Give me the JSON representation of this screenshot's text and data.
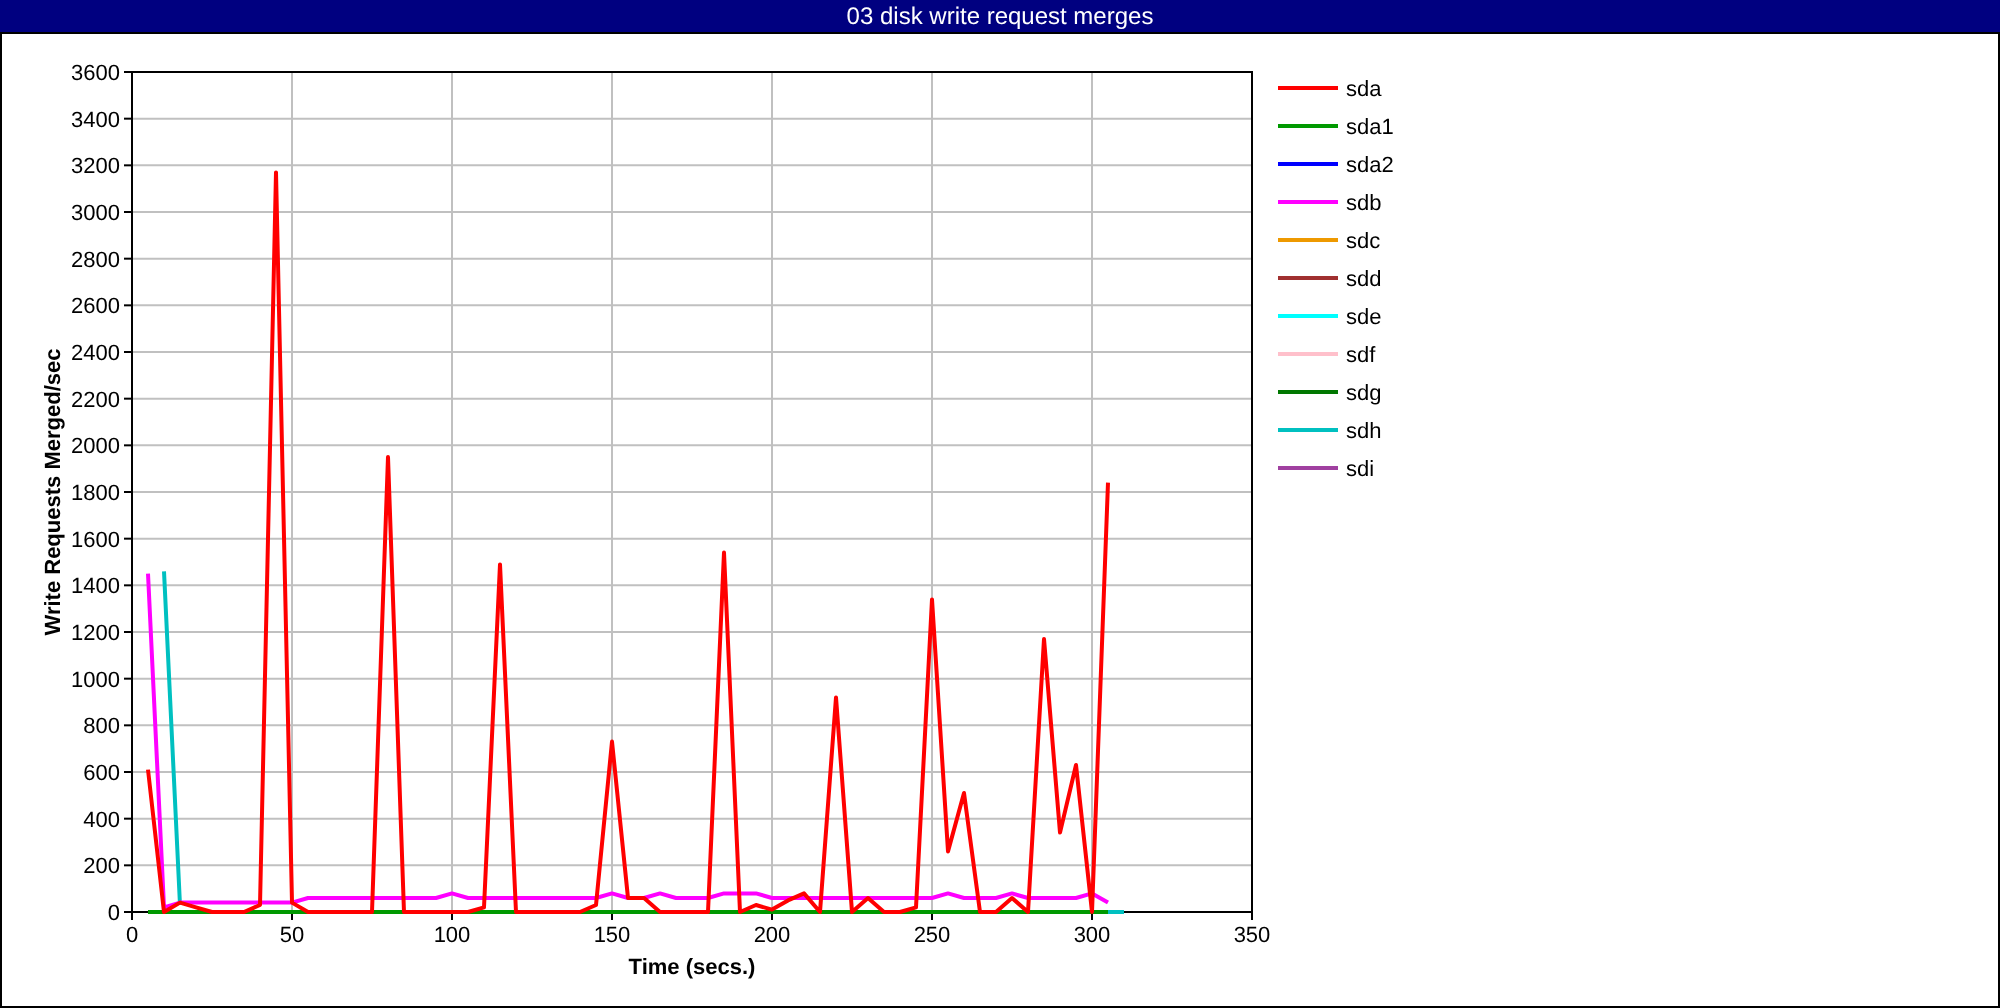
{
  "window": {
    "title": "03 disk write request merges"
  },
  "chart_data": {
    "type": "line",
    "xlabel": "Time (secs.)",
    "ylabel": "Write Requests Merged/sec",
    "xlim": [
      0,
      350
    ],
    "ylim": [
      0,
      3600
    ],
    "grid": true,
    "legend": true,
    "xticks": [
      0,
      50,
      100,
      150,
      200,
      250,
      300,
      350
    ],
    "yticks": [
      0,
      200,
      400,
      600,
      800,
      1000,
      1200,
      1400,
      1600,
      1800,
      2000,
      2200,
      2400,
      2600,
      2800,
      3000,
      3200,
      3400,
      3600
    ],
    "x": [
      5,
      10,
      15,
      20,
      25,
      30,
      35,
      40,
      45,
      50,
      55,
      60,
      65,
      70,
      75,
      80,
      85,
      90,
      95,
      100,
      105,
      110,
      115,
      120,
      125,
      130,
      135,
      140,
      145,
      150,
      155,
      160,
      165,
      170,
      175,
      180,
      185,
      190,
      195,
      200,
      205,
      210,
      215,
      220,
      225,
      230,
      235,
      240,
      245,
      250,
      255,
      260,
      265,
      270,
      275,
      280,
      285,
      290,
      295,
      300,
      305,
      310
    ],
    "series": [
      {
        "name": "sda",
        "color": "#ff0000",
        "values": [
          610,
          0,
          40,
          20,
          0,
          0,
          0,
          30,
          3170,
          40,
          0,
          0,
          0,
          0,
          0,
          1950,
          0,
          0,
          0,
          0,
          0,
          20,
          1490,
          0,
          0,
          0,
          0,
          0,
          30,
          730,
          60,
          60,
          0,
          0,
          0,
          0,
          1540,
          0,
          30,
          10,
          50,
          80,
          0,
          920,
          0,
          60,
          0,
          0,
          20,
          1340,
          260,
          510,
          0,
          0,
          60,
          0,
          1170,
          340,
          630,
          0,
          1840,
          null
        ]
      },
      {
        "name": "sda1",
        "color": "#009900",
        "values": [
          0,
          0,
          0,
          0,
          0,
          0,
          0,
          0,
          0,
          0,
          0,
          0,
          0,
          0,
          0,
          0,
          0,
          0,
          0,
          0,
          0,
          0,
          0,
          0,
          0,
          0,
          0,
          0,
          0,
          0,
          0,
          0,
          0,
          0,
          0,
          0,
          0,
          0,
          0,
          0,
          0,
          0,
          0,
          0,
          0,
          0,
          0,
          0,
          0,
          0,
          0,
          0,
          0,
          0,
          0,
          0,
          0,
          0,
          0,
          0,
          0,
          null
        ]
      },
      {
        "name": "sda2",
        "color": "#0000ff",
        "values": [
          null,
          null,
          null,
          null,
          null,
          null,
          null,
          null,
          null,
          null,
          null,
          null,
          null,
          null,
          null,
          null,
          null,
          null,
          null,
          null,
          null,
          null,
          null,
          null,
          null,
          null,
          null,
          null,
          null,
          null,
          null,
          null,
          null,
          null,
          null,
          null,
          null,
          null,
          null,
          null,
          null,
          null,
          null,
          null,
          null,
          null,
          null,
          null,
          null,
          null,
          null,
          null,
          null,
          null,
          null,
          null,
          null,
          null,
          null,
          null,
          null,
          null
        ]
      },
      {
        "name": "sdb",
        "color": "#ff00ff",
        "values": [
          1450,
          20,
          40,
          40,
          40,
          40,
          40,
          40,
          40,
          40,
          60,
          60,
          60,
          60,
          60,
          60,
          60,
          60,
          60,
          80,
          60,
          60,
          60,
          60,
          60,
          60,
          60,
          60,
          60,
          80,
          60,
          60,
          80,
          60,
          60,
          60,
          80,
          80,
          80,
          60,
          60,
          60,
          60,
          60,
          60,
          60,
          60,
          60,
          60,
          60,
          80,
          60,
          60,
          60,
          80,
          60,
          60,
          60,
          60,
          80,
          40,
          null
        ]
      },
      {
        "name": "sdc",
        "color": "#ee9900",
        "values": [
          null,
          null,
          null,
          null,
          null,
          null,
          null,
          null,
          null,
          null,
          null,
          null,
          null,
          null,
          null,
          null,
          null,
          null,
          null,
          null,
          null,
          null,
          null,
          null,
          null,
          null,
          null,
          null,
          null,
          null,
          null,
          null,
          null,
          null,
          null,
          null,
          null,
          null,
          null,
          null,
          null,
          null,
          null,
          null,
          null,
          null,
          null,
          null,
          null,
          null,
          null,
          null,
          null,
          null,
          null,
          null,
          null,
          null,
          null,
          null,
          null,
          null
        ]
      },
      {
        "name": "sdd",
        "color": "#a03030",
        "values": [
          null,
          null,
          null,
          null,
          null,
          null,
          null,
          null,
          null,
          null,
          null,
          null,
          null,
          null,
          null,
          null,
          null,
          null,
          null,
          null,
          null,
          null,
          null,
          null,
          null,
          null,
          null,
          null,
          null,
          null,
          null,
          null,
          null,
          null,
          null,
          null,
          null,
          null,
          null,
          null,
          null,
          null,
          null,
          null,
          null,
          null,
          null,
          null,
          null,
          null,
          null,
          null,
          null,
          null,
          null,
          null,
          null,
          null,
          null,
          null,
          null,
          null
        ]
      },
      {
        "name": "sde",
        "color": "#00ffff",
        "values": [
          null,
          null,
          null,
          null,
          null,
          null,
          null,
          null,
          null,
          null,
          null,
          null,
          null,
          null,
          null,
          null,
          null,
          null,
          null,
          null,
          null,
          null,
          null,
          null,
          null,
          null,
          null,
          null,
          null,
          null,
          null,
          null,
          null,
          null,
          null,
          null,
          null,
          null,
          null,
          null,
          null,
          null,
          null,
          null,
          null,
          null,
          null,
          null,
          null,
          null,
          null,
          null,
          null,
          null,
          null,
          null,
          null,
          null,
          null,
          null,
          null,
          null
        ]
      },
      {
        "name": "sdf",
        "color": "#ffc0cb",
        "values": [
          null,
          null,
          null,
          null,
          null,
          null,
          null,
          null,
          null,
          null,
          null,
          null,
          null,
          null,
          null,
          null,
          null,
          null,
          null,
          null,
          null,
          null,
          null,
          null,
          null,
          null,
          null,
          null,
          null,
          null,
          null,
          null,
          null,
          null,
          null,
          null,
          null,
          null,
          null,
          null,
          null,
          null,
          null,
          null,
          null,
          null,
          null,
          null,
          null,
          null,
          null,
          null,
          null,
          null,
          null,
          null,
          null,
          null,
          null,
          null,
          null,
          null
        ]
      },
      {
        "name": "sdg",
        "color": "#007700",
        "values": [
          null,
          null,
          null,
          null,
          null,
          null,
          null,
          null,
          null,
          null,
          null,
          null,
          null,
          null,
          null,
          null,
          null,
          null,
          null,
          null,
          null,
          null,
          null,
          null,
          null,
          null,
          null,
          null,
          null,
          null,
          null,
          null,
          null,
          null,
          null,
          null,
          null,
          null,
          null,
          null,
          null,
          null,
          null,
          null,
          null,
          null,
          null,
          null,
          null,
          null,
          null,
          null,
          null,
          null,
          null,
          null,
          null,
          null,
          null,
          null,
          null,
          null
        ]
      },
      {
        "name": "sdh",
        "color": "#00c0c0",
        "values": [
          null,
          1460,
          30,
          null,
          null,
          null,
          null,
          null,
          null,
          null,
          null,
          null,
          null,
          null,
          null,
          null,
          null,
          null,
          null,
          null,
          null,
          null,
          null,
          null,
          null,
          null,
          null,
          null,
          null,
          null,
          null,
          null,
          null,
          null,
          null,
          null,
          null,
          null,
          null,
          null,
          null,
          null,
          null,
          null,
          null,
          null,
          null,
          null,
          null,
          null,
          null,
          null,
          null,
          null,
          null,
          null,
          null,
          null,
          null,
          null,
          0,
          0
        ]
      },
      {
        "name": "sdi",
        "color": "#a040a0",
        "values": [
          null,
          null,
          null,
          null,
          null,
          null,
          null,
          null,
          null,
          null,
          null,
          null,
          null,
          null,
          null,
          null,
          null,
          null,
          null,
          null,
          null,
          null,
          null,
          null,
          null,
          null,
          null,
          null,
          null,
          null,
          null,
          null,
          null,
          null,
          null,
          null,
          null,
          null,
          null,
          null,
          null,
          null,
          null,
          null,
          null,
          null,
          null,
          null,
          null,
          null,
          null,
          null,
          null,
          null,
          null,
          null,
          null,
          null,
          null,
          null,
          null,
          null
        ]
      }
    ]
  }
}
